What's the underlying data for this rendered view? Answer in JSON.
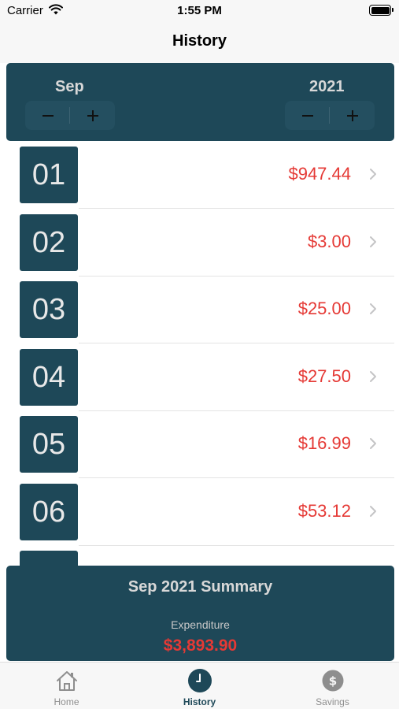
{
  "status_bar": {
    "carrier": "Carrier",
    "time": "1:55 PM"
  },
  "nav": {
    "title": "History"
  },
  "picker": {
    "month": "Sep",
    "year": "2021",
    "minus_symbol": "−",
    "plus_symbol": "+"
  },
  "entries": [
    {
      "day": "01",
      "amount": "$947.44"
    },
    {
      "day": "02",
      "amount": "$3.00"
    },
    {
      "day": "03",
      "amount": "$25.00"
    },
    {
      "day": "04",
      "amount": "$27.50"
    },
    {
      "day": "05",
      "amount": "$16.99"
    },
    {
      "day": "06",
      "amount": "$53.12"
    }
  ],
  "summary": {
    "title": "Sep 2021 Summary",
    "expenditure_label": "Expenditure",
    "expenditure_value": "$3,893.90"
  },
  "tabs": [
    {
      "label": "Home",
      "icon": "house-icon",
      "active": false
    },
    {
      "label": "History",
      "icon": "clock-icon",
      "active": true
    },
    {
      "label": "Savings",
      "icon": "dollar-coin-icon",
      "active": false
    }
  ],
  "colors": {
    "primary": "#1e4858",
    "amount": "#e53935",
    "panel_text": "#d8d8d8",
    "inactive_tab": "#8e8e8e"
  }
}
